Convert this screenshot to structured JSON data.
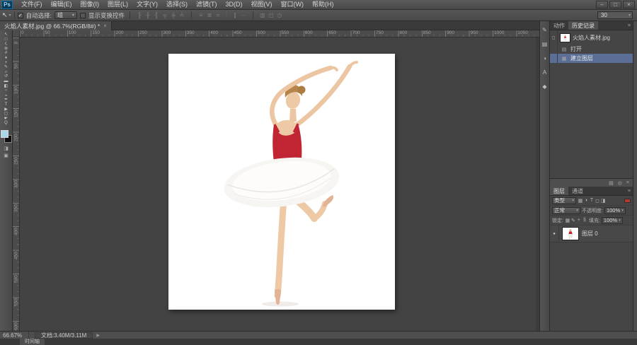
{
  "window": {
    "minimize": "–",
    "restore": "□",
    "close": "×"
  },
  "menubar": {
    "logo": "Ps",
    "items": [
      {
        "name": "file",
        "label": "文件(F)"
      },
      {
        "name": "edit",
        "label": "编辑(E)"
      },
      {
        "name": "image",
        "label": "图像(I)"
      },
      {
        "name": "layer",
        "label": "图层(L)"
      },
      {
        "name": "type",
        "label": "文字(Y)"
      },
      {
        "name": "select",
        "label": "选择(S)"
      },
      {
        "name": "filter",
        "label": "滤镜(T)"
      },
      {
        "name": "3d",
        "label": "3D(D)"
      },
      {
        "name": "view",
        "label": "视图(V)"
      },
      {
        "name": "window",
        "label": "窗口(W)"
      },
      {
        "name": "help",
        "label": "帮助(H)"
      }
    ]
  },
  "options_bar": {
    "tool_glyph": "↖",
    "tool_arrow": "▾",
    "auto_select_checked": "✓",
    "auto_select_label": "自动选择:",
    "group_value": "组",
    "group_arrow": "▾",
    "show_transform_label": "显示变换控件",
    "align_icons": [
      {
        "name": "align-left-icon",
        "glyph": "╟"
      },
      {
        "name": "align-hcenter-icon",
        "glyph": "╫"
      },
      {
        "name": "align-right-icon",
        "glyph": "╢"
      },
      {
        "name": "align-top-icon",
        "glyph": "╤"
      },
      {
        "name": "align-vcenter-icon",
        "glyph": "╪"
      },
      {
        "name": "align-bottom-icon",
        "glyph": "╧"
      }
    ],
    "distribute_icons": [
      {
        "name": "distribute-top-icon",
        "glyph": "≡"
      },
      {
        "name": "distribute-vcenter-icon",
        "glyph": "≣"
      },
      {
        "name": "distribute-bottom-icon",
        "glyph": "≍"
      },
      {
        "name": "distribute-left-icon",
        "glyph": "⋮"
      },
      {
        "name": "distribute-hcenter-icon",
        "glyph": "∥"
      },
      {
        "name": "distribute-right-icon",
        "glyph": "⋯"
      }
    ],
    "extra_icons": [
      {
        "name": "auto-align-layers-icon",
        "glyph": "▥"
      },
      {
        "name": "3d-mode-rotate-icon",
        "glyph": "◰"
      },
      {
        "name": "3d-mode-orbit-icon",
        "glyph": "◷"
      }
    ],
    "right_field_value": "30",
    "right_field_arrow": "▾"
  },
  "document_tab": {
    "title": "火焰人素材.jpg @ 66.7%(RGB/8#) *",
    "close_glyph": "×"
  },
  "toolbar": {
    "tools": [
      {
        "name": "move-tool",
        "glyph": "↖"
      },
      {
        "name": "rectangular-marquee-tool",
        "glyph": "□"
      },
      {
        "name": "lasso-tool",
        "glyph": "ς"
      },
      {
        "name": "quick-selection-tool",
        "glyph": "⊛"
      },
      {
        "name": "crop-tool",
        "glyph": "#"
      },
      {
        "name": "eyedropper-tool",
        "glyph": "♦"
      },
      {
        "name": "spot-healing-tool",
        "glyph": "+"
      },
      {
        "name": "brush-tool",
        "glyph": "✎"
      },
      {
        "name": "clone-stamp-tool",
        "glyph": "⌂"
      },
      {
        "name": "history-brush-tool",
        "glyph": "↺"
      },
      {
        "name": "eraser-tool",
        "glyph": "▬"
      },
      {
        "name": "gradient-tool",
        "glyph": "◧"
      },
      {
        "name": "blur-tool",
        "glyph": "○"
      },
      {
        "name": "dodge-tool",
        "glyph": "◒"
      },
      {
        "name": "pen-tool",
        "glyph": "✒"
      },
      {
        "name": "type-tool",
        "glyph": "T"
      },
      {
        "name": "path-selection-tool",
        "glyph": "▶"
      },
      {
        "name": "shape-tool",
        "glyph": "◻"
      },
      {
        "name": "hand-tool",
        "glyph": "☛"
      },
      {
        "name": "zoom-tool",
        "glyph": "Ϙ"
      }
    ],
    "foreground_color": "#a9d6e8",
    "background_color": "#111111",
    "quick_mask_glyph": "◨",
    "screen_mode_glyph": "▣"
  },
  "rulers": {
    "horizontal": [
      "0",
      "50",
      "100",
      "150",
      "200",
      "250",
      "300",
      "350",
      "400",
      "450",
      "500",
      "550",
      "600",
      "650",
      "700",
      "750",
      "800",
      "850",
      "900",
      "950",
      "1000",
      "1050"
    ],
    "vertical": [
      "0",
      "50",
      "100",
      "150",
      "200",
      "250",
      "300",
      "350",
      "400",
      "450",
      "500",
      "550",
      "600"
    ]
  },
  "dock_icons": [
    {
      "name": "brush-panel-icon",
      "glyph": "✎"
    },
    {
      "name": "color-panel-icon",
      "glyph": "▤"
    },
    {
      "name": "adjustments-panel-icon",
      "glyph": "◑"
    },
    {
      "name": "character-panel-icon",
      "glyph": "A"
    },
    {
      "name": "styles-panel-icon",
      "glyph": "◆"
    }
  ],
  "history_panel": {
    "tabs": [
      {
        "name": "tab-actions",
        "label": "动作",
        "active": false
      },
      {
        "name": "tab-history",
        "label": "历史记录",
        "active": true
      }
    ],
    "menu_glyph": "≡",
    "snapshot": {
      "source_glyph": "◻",
      "name": "火焰人素材.jpg"
    },
    "states": [
      {
        "icon": "▤",
        "label": "打开",
        "selected": false
      },
      {
        "icon": "▦",
        "label": "建立图层",
        "selected": true
      }
    ],
    "footer_icons": [
      {
        "name": "new-document-from-state-icon",
        "glyph": "▤"
      },
      {
        "name": "new-snapshot-icon",
        "glyph": "◎"
      },
      {
        "name": "delete-state-icon",
        "glyph": "×"
      }
    ]
  },
  "layers_panel": {
    "tabs": [
      {
        "name": "tab-layers",
        "label": "图层",
        "active": true
      },
      {
        "name": "tab-channels",
        "label": "通道",
        "active": false
      }
    ],
    "menu_glyph": "≡",
    "filter_label": "类型",
    "filter_arrow": "▾",
    "filter_icons": [
      {
        "name": "filter-pixel-layers-icon",
        "glyph": "▦"
      },
      {
        "name": "filter-adjustment-layers-icon",
        "glyph": "◑"
      },
      {
        "name": "filter-type-layers-icon",
        "glyph": "T"
      },
      {
        "name": "filter-shape-layers-icon",
        "glyph": "◻"
      },
      {
        "name": "filter-smart-objects-icon",
        "glyph": "◨"
      }
    ],
    "blend_mode": "正常",
    "blend_arrow": "▾",
    "opacity_label": "不透明度:",
    "opacity_value": "100%",
    "lock_label": "锁定:",
    "lock_icons": [
      {
        "name": "lock-transparent-pixels-icon",
        "glyph": "▦"
      },
      {
        "name": "lock-image-pixels-icon",
        "glyph": "✎"
      },
      {
        "name": "lock-position-icon",
        "glyph": "+"
      },
      {
        "name": "lock-all-icon",
        "glyph": "§"
      }
    ],
    "fill_label": "填充:",
    "fill_value": "100%",
    "layers": [
      {
        "eye": "●",
        "name": "图层 0"
      }
    ]
  },
  "status_bar": {
    "zoom": "66.67%",
    "doc_info": "文档:3.40M/3.11M",
    "expand_glyph": "▶"
  },
  "bottom_bar": {
    "timeline_label": "时间轴"
  }
}
